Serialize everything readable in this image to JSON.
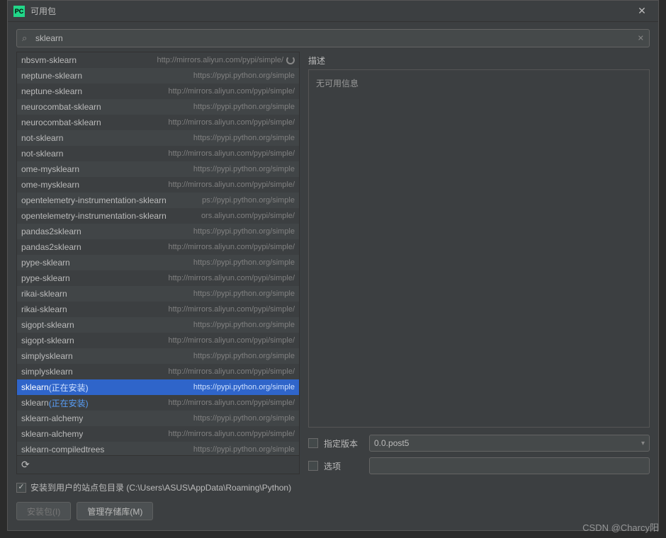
{
  "window": {
    "logo_text": "PC",
    "title": "可用包",
    "close_glyph": "✕"
  },
  "search": {
    "icon_glyph": "⌕",
    "value": "sklearn",
    "clear_glyph": "✕"
  },
  "packages": [
    {
      "name": "nbsvm-sklearn",
      "repo": "http://mirrors.aliyun.com/pypi/simple/",
      "loading": true
    },
    {
      "name": "neptune-sklearn",
      "repo": "https://pypi.python.org/simple"
    },
    {
      "name": "neptune-sklearn",
      "repo": "http://mirrors.aliyun.com/pypi/simple/"
    },
    {
      "name": "neurocombat-sklearn",
      "repo": "https://pypi.python.org/simple"
    },
    {
      "name": "neurocombat-sklearn",
      "repo": "http://mirrors.aliyun.com/pypi/simple/"
    },
    {
      "name": "not-sklearn",
      "repo": "https://pypi.python.org/simple"
    },
    {
      "name": "not-sklearn",
      "repo": "http://mirrors.aliyun.com/pypi/simple/"
    },
    {
      "name": "ome-mysklearn",
      "repo": "https://pypi.python.org/simple"
    },
    {
      "name": "ome-mysklearn",
      "repo": "http://mirrors.aliyun.com/pypi/simple/"
    },
    {
      "name": "opentelemetry-instrumentation-sklearn",
      "repo": "ps://pypi.python.org/simple"
    },
    {
      "name": "opentelemetry-instrumentation-sklearn",
      "repo": "ors.aliyun.com/pypi/simple/"
    },
    {
      "name": "pandas2sklearn",
      "repo": "https://pypi.python.org/simple"
    },
    {
      "name": "pandas2sklearn",
      "repo": "http://mirrors.aliyun.com/pypi/simple/"
    },
    {
      "name": "pype-sklearn",
      "repo": "https://pypi.python.org/simple"
    },
    {
      "name": "pype-sklearn",
      "repo": "http://mirrors.aliyun.com/pypi/simple/"
    },
    {
      "name": "rikai-sklearn",
      "repo": "https://pypi.python.org/simple"
    },
    {
      "name": "rikai-sklearn",
      "repo": "http://mirrors.aliyun.com/pypi/simple/"
    },
    {
      "name": "sigopt-sklearn",
      "repo": "https://pypi.python.org/simple"
    },
    {
      "name": "sigopt-sklearn",
      "repo": "http://mirrors.aliyun.com/pypi/simple/"
    },
    {
      "name": "simplysklearn",
      "repo": "https://pypi.python.org/simple"
    },
    {
      "name": "simplysklearn",
      "repo": "http://mirrors.aliyun.com/pypi/simple/"
    },
    {
      "name": "sklearn",
      "installing": "(正在安装)",
      "repo": "https://pypi.python.org/simple",
      "selected": true
    },
    {
      "name": "sklearn",
      "installing": "(正在安装)",
      "repo": "http://mirrors.aliyun.com/pypi/simple/"
    },
    {
      "name": "sklearn-alchemy",
      "repo": "https://pypi.python.org/simple"
    },
    {
      "name": "sklearn-alchemy",
      "repo": "http://mirrors.aliyun.com/pypi/simple/"
    },
    {
      "name": "sklearn-compiledtrees",
      "repo": "https://pypi.python.org/simple"
    }
  ],
  "refresh_glyph": "⟳",
  "description": {
    "label": "描述",
    "no_info": "无可用信息"
  },
  "controls": {
    "specify_version_label": "指定版本",
    "version_value": "0.0.post5",
    "chevron_glyph": "▾",
    "options_label": "选项"
  },
  "footer": {
    "install_to_user_dir": "安装到用户的站点包目录 (C:\\Users\\ASUS\\AppData\\Roaming\\Python)",
    "install_btn": "安装包(I)",
    "manage_repos_btn": "管理存储库(M)"
  },
  "watermark": "CSDN @Charcy阳"
}
